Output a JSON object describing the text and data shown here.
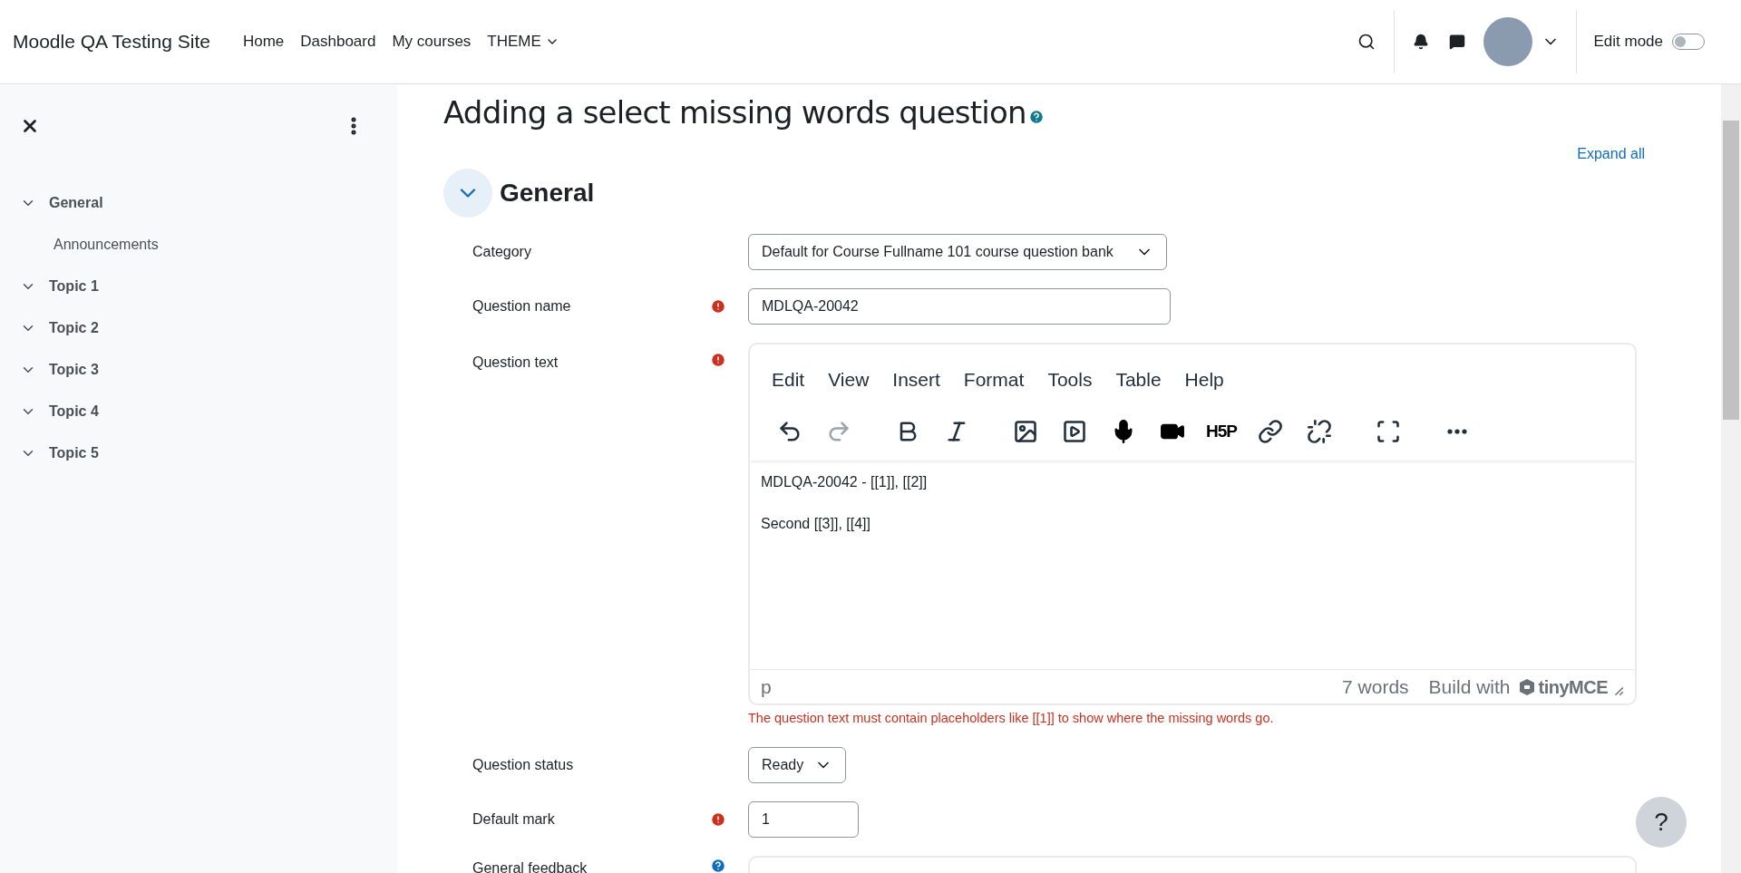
{
  "site_name": "Moodle QA Testing Site",
  "nav": [
    {
      "label": "Home",
      "dropdown": false
    },
    {
      "label": "Dashboard",
      "dropdown": false
    },
    {
      "label": "My courses",
      "dropdown": false
    },
    {
      "label": "THEME",
      "dropdown": true
    }
  ],
  "edit_mode": {
    "label": "Edit mode",
    "on": false
  },
  "sidebar": {
    "items": [
      {
        "label": "General",
        "expanded": true,
        "children": [
          {
            "label": "Announcements"
          }
        ]
      },
      {
        "label": "Topic 1",
        "expanded": true
      },
      {
        "label": "Topic 2",
        "expanded": true
      },
      {
        "label": "Topic 3",
        "expanded": true
      },
      {
        "label": "Topic 4",
        "expanded": true
      },
      {
        "label": "Topic 5",
        "expanded": true
      }
    ]
  },
  "page_title": "Adding a select missing words question",
  "expand_all": "Expand all",
  "section": {
    "title": "General",
    "expanded": true
  },
  "fields": [
    {
      "kind": "select",
      "label": "Category",
      "required": false,
      "value": "Default for Course Fullname 101 course question bank"
    },
    {
      "kind": "text",
      "label": "Question name",
      "required": true,
      "value": "MDLQA-20042"
    },
    {
      "kind": "editor",
      "label": "Question text",
      "required": true,
      "menu": [
        "Edit",
        "View",
        "Insert",
        "Format",
        "Tools",
        "Table",
        "Help"
      ],
      "toolbar": [
        {
          "kind": "undo",
          "disabled": false
        },
        {
          "kind": "redo",
          "disabled": true
        },
        {
          "kind": "bold",
          "disabled": false
        },
        {
          "kind": "italic",
          "disabled": false
        },
        {
          "kind": "image",
          "disabled": false
        },
        {
          "kind": "media",
          "disabled": false
        },
        {
          "kind": "mic",
          "disabled": false
        },
        {
          "kind": "video",
          "disabled": false
        },
        {
          "kind": "h5p",
          "label": "H5P",
          "disabled": false
        },
        {
          "kind": "link",
          "disabled": false
        },
        {
          "kind": "unlink",
          "disabled": false
        },
        {
          "kind": "fullscreen",
          "disabled": false
        },
        {
          "kind": "more",
          "disabled": false
        }
      ],
      "paragraphs": [
        "MDLQA-20042 - [[1]], [[2]]",
        "Second [[3]], [[4]]"
      ],
      "path": "p",
      "word_count": "7 words",
      "branding": "Build with",
      "brand": "tinyMCE",
      "error": "The question text must contain placeholders like [[1]] to show where the missing words go."
    },
    {
      "kind": "smallselect",
      "label": "Question status",
      "required": false,
      "value": "Ready"
    },
    {
      "kind": "smalltext",
      "label": "Default mark",
      "required": true,
      "value": "1"
    },
    {
      "kind": "editorstub",
      "label": "General feedback",
      "required": false,
      "help": true
    }
  ],
  "help_button": "?"
}
